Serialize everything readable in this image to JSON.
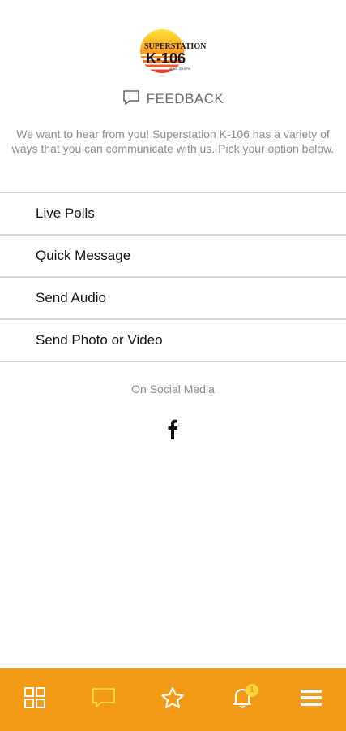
{
  "logo": {
    "line1": "SUPERSTATION",
    "line2": "K-106",
    "line3": "NEWS, 106.5 FM"
  },
  "header": {
    "title": "FEEDBACK",
    "icon": "message-icon"
  },
  "intro": "We want to hear from you! Superstation K-106 has a variety of ways that you can communicate with us. Pick your option below.",
  "options": [
    {
      "label": "Live Polls"
    },
    {
      "label": "Quick Message"
    },
    {
      "label": "Send Audio"
    },
    {
      "label": "Send Photo or Video"
    }
  ],
  "social": {
    "label": "On Social Media",
    "icons": [
      "facebook-icon"
    ]
  },
  "bottom_nav": {
    "items": [
      "grid-icon",
      "message-icon",
      "star-icon",
      "bell-icon",
      "menu-icon"
    ],
    "active": "message-icon",
    "notification_count": "1",
    "background_color": "#f39a17",
    "active_color": "#ffd43b"
  }
}
